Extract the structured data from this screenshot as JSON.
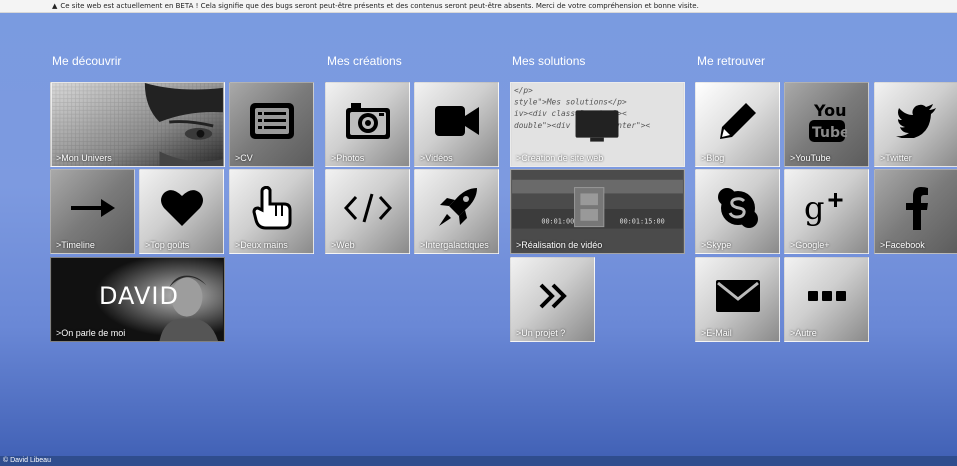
{
  "beta_notice": "Ce site web est actuellement en BETA ! Cela signifie que des bugs seront peut-être présents et des contenus seront peut-être absents. Merci de votre compréhension et bonne visite.",
  "sections": {
    "decouvrir": "Me découvrir",
    "creations": "Mes créations",
    "solutions": "Mes solutions",
    "retrouver": "Me retrouver"
  },
  "tiles": {
    "mon_univers": ">Mon Univers",
    "cv": ">CV",
    "timeline": ">Timeline",
    "top_gouts": ">Top goûts",
    "deux_mains": ">Deux mains",
    "on_parle": ">On parle de moi",
    "david": "DAVID",
    "photos": ">Photos",
    "videos": ">Vidéos",
    "web": ">Web",
    "intergalactiques": ">Intergalactiques",
    "creation_site": ">Création de site web",
    "realisation_video": ">Réalisation de vidéo",
    "un_projet": ">Un projet ?",
    "blog": ">Blog",
    "youtube": ">YouTube",
    "twitter": ">Twitter",
    "skype": ">Skype",
    "googleplus": ">Google+",
    "facebook": ">Facebook",
    "email": ">E-Mail",
    "autre": ">Autre"
  },
  "footer": "© David Libeau"
}
